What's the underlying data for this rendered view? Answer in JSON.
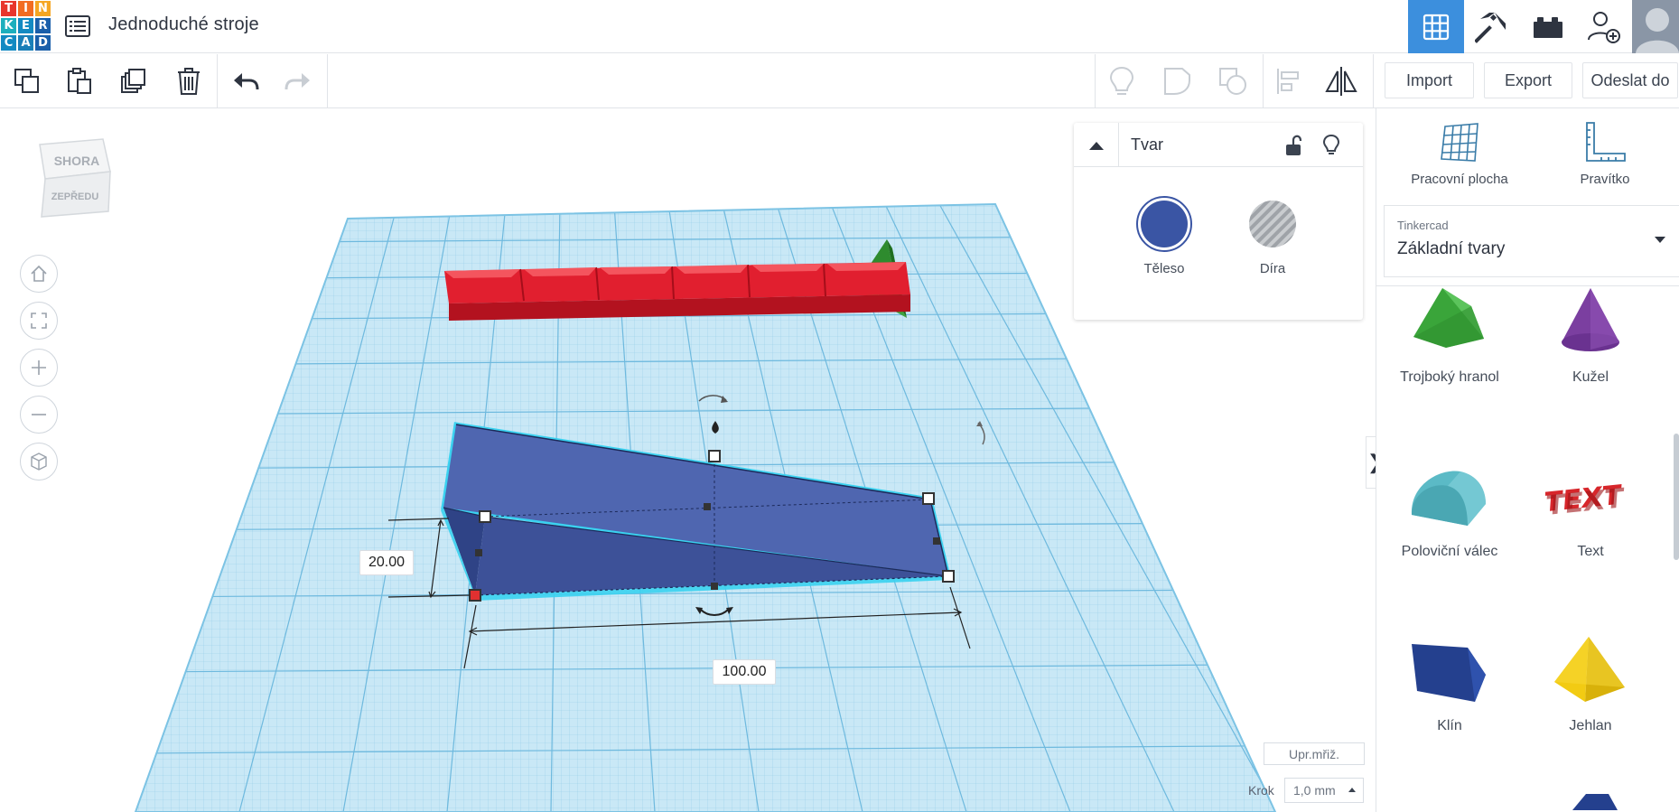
{
  "app": {
    "logo_letters": [
      "T",
      "I",
      "N",
      "K",
      "E",
      "R",
      "C",
      "A",
      "D"
    ],
    "title": "Jednoduché stroje"
  },
  "topbar": {
    "buttons": [
      {
        "name": "3d-design-view",
        "icon": "grid-icon",
        "active": true
      },
      {
        "name": "blocks-view",
        "icon": "pickaxe-icon",
        "active": false
      },
      {
        "name": "bricks-view",
        "icon": "brick-icon",
        "active": false
      },
      {
        "name": "invite-user",
        "icon": "add-user-icon",
        "active": false
      },
      {
        "name": "profile",
        "icon": "avatar",
        "active": false
      }
    ]
  },
  "toolbar": {
    "tools": [
      "copy-icon",
      "paste-icon",
      "duplicate-icon",
      "delete-icon",
      "undo-icon",
      "redo-icon"
    ],
    "right_tools": [
      "show-all-icon",
      "group-icon",
      "ungroup-icon",
      "align-icon",
      "mirror-icon"
    ],
    "import_label": "Import",
    "export_label": "Export",
    "send_label": "Odeslat do"
  },
  "viewcube": {
    "top": "SHORA",
    "front": "ZEPŘEDU"
  },
  "nav_buttons": [
    "home-icon",
    "fit-view-icon",
    "zoom-in-icon",
    "zoom-out-icon",
    "perspective-icon"
  ],
  "inspector": {
    "title": "Tvar",
    "solid_label": "Těleso",
    "hole_label": "Díra",
    "solid_color": "#3a55a4"
  },
  "dimensions": {
    "height": "20.00",
    "length": "100.00"
  },
  "workplane": {
    "grid_button": "Upr.mřiž.",
    "step_label": "Krok",
    "step_value": "1,0 mm"
  },
  "right_panel": {
    "workplane_label": "Pracovní plocha",
    "ruler_label": "Pravítko",
    "library_source": "Tinkercad",
    "library_name": "Základní tvary",
    "shapes": [
      {
        "label": "Trojboký hranol",
        "color": "#3aa53a"
      },
      {
        "label": "Kužel",
        "color": "#7b3fa0"
      },
      {
        "label": "Poloviční válec",
        "color": "#5bbac6"
      },
      {
        "label": "Text",
        "color": "#d7262b"
      },
      {
        "label": "Klín",
        "color": "#24408e"
      },
      {
        "label": "Jehlan",
        "color": "#f2cb13"
      }
    ],
    "toggle_glyph": "❯"
  },
  "colors": {
    "accent": "#3c8fdd",
    "grid": "#a9d8ef",
    "selected_shape": "#4a62ad",
    "red_blocks": "#e11f2f",
    "green_prism": "#2e8b2e"
  }
}
